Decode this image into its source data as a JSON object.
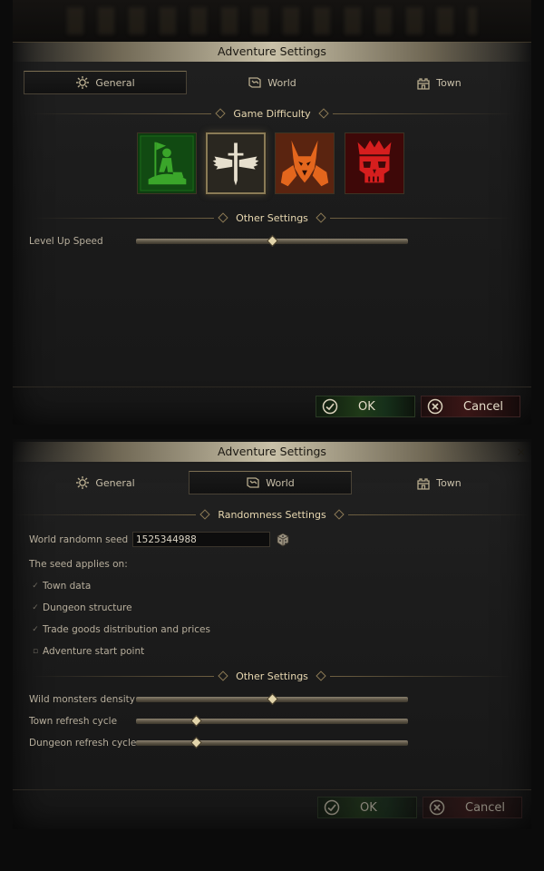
{
  "panel1": {
    "title": "Adventure Settings",
    "tabs": [
      {
        "label": "General",
        "icon": "gear-icon",
        "active": true
      },
      {
        "label": "World",
        "icon": "map-icon",
        "active": false
      },
      {
        "label": "Town",
        "icon": "castle-icon",
        "active": false
      }
    ],
    "difficulty_title": "Game Difficulty",
    "difficulties": [
      {
        "name": "easy",
        "icon": "flag-figure-icon",
        "selected": false,
        "color": "#2f8f1e"
      },
      {
        "name": "normal",
        "icon": "winged-sword-icon",
        "selected": true,
        "color": "#e8e0cf"
      },
      {
        "name": "hard",
        "icon": "horned-demon-icon",
        "selected": false,
        "color": "#d8581a"
      },
      {
        "name": "impossible",
        "icon": "crowned-skull-icon",
        "selected": false,
        "color": "#d21b1b"
      }
    ],
    "other_title": "Other Settings",
    "level_up_label": "Level Up Speed",
    "level_up_value": 0.5,
    "ok_label": "OK",
    "cancel_label": "Cancel"
  },
  "panel2": {
    "title": "Adventure Settings",
    "close_label": "×",
    "tabs": [
      {
        "label": "General",
        "icon": "gear-icon",
        "active": false
      },
      {
        "label": "World",
        "icon": "map-icon",
        "active": true
      },
      {
        "label": "Town",
        "icon": "castle-icon",
        "active": false
      }
    ],
    "randomness_title": "Randomness Settings",
    "seed_label": "World randomn seed",
    "seed_value": "1525344988",
    "applies_label": "The seed applies on:",
    "checks": [
      {
        "label": "Town data",
        "checked": true
      },
      {
        "label": "Dungeon structure",
        "checked": true
      },
      {
        "label": "Trade goods distribution and prices",
        "checked": true
      },
      {
        "label": "Adventure start point",
        "checked": false
      }
    ],
    "other_title": "Other Settings",
    "sliders": [
      {
        "label": "Wild monsters density",
        "value": 0.5
      },
      {
        "label": "Town refresh cycle",
        "value": 0.22
      },
      {
        "label": "Dungeon refresh cycle",
        "value": 0.22
      }
    ],
    "ok_label": "OK",
    "cancel_label": "Cancel"
  },
  "colors": {
    "accent_gold": "#e7d7b0",
    "ok_green": "#1f3a18",
    "cancel_red": "#3a1616"
  }
}
